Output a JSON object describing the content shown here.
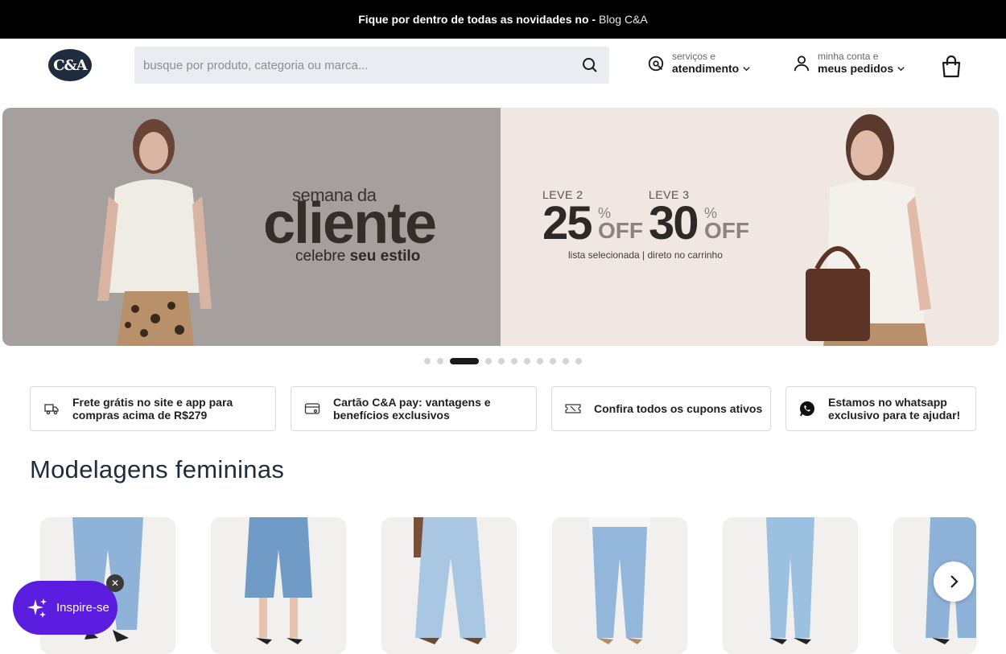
{
  "topbar": {
    "text": "Fique por dentro de todas as novidades no -",
    "link": "Blog C&A"
  },
  "header": {
    "logo": "C&A",
    "search_placeholder": "busque por produto, categoria ou marca...",
    "services": {
      "small": "serviços e",
      "big": "atendimento"
    },
    "account": {
      "small": "minha conta e",
      "big": "meus pedidos"
    }
  },
  "banner": {
    "semana": "semana",
    "da": "da",
    "cliente": "cliente",
    "celebre": "celebre",
    "seu_estilo": "seu estilo",
    "offer1": {
      "leve": "LEVE 2",
      "num": "25",
      "pct": "%",
      "off": "OFF"
    },
    "offer2": {
      "leve": "LEVE 3",
      "num": "30",
      "pct": "%",
      "off": "OFF"
    },
    "lista": "lista selecionada | direto no carrinho",
    "colors": {
      "left_bg": "#a5a09e",
      "right_bg": "#f0e6e2"
    }
  },
  "carousel": {
    "total": 11,
    "active_index": 2
  },
  "info_cards": [
    {
      "icon": "truck-icon",
      "text": "Frete grátis no site e app para\ncompras acima de R$279"
    },
    {
      "icon": "credit-card-icon",
      "text": "Cartão C&A pay: vantagens e\nbenefícios exclusivos"
    },
    {
      "icon": "coupon-icon",
      "text": "Confira todos os cupons ativos"
    },
    {
      "icon": "whatsapp-icon",
      "text": "Estamos no whatsapp\nexclusivo para te ajudar!"
    }
  ],
  "section": {
    "title": "Modelagens femininas"
  },
  "products": [
    {
      "name": "wide-leg-jeans"
    },
    {
      "name": "denim-bermuda"
    },
    {
      "name": "baggy-jeans"
    },
    {
      "name": "mom-jeans"
    },
    {
      "name": "straight-jeans"
    },
    {
      "name": "flare-jeans"
    }
  ],
  "inspire": {
    "label": "Inspire-se",
    "close": "✕"
  },
  "accent": {
    "brand": "#1f2c3d",
    "inspire": "#5a1de0"
  }
}
